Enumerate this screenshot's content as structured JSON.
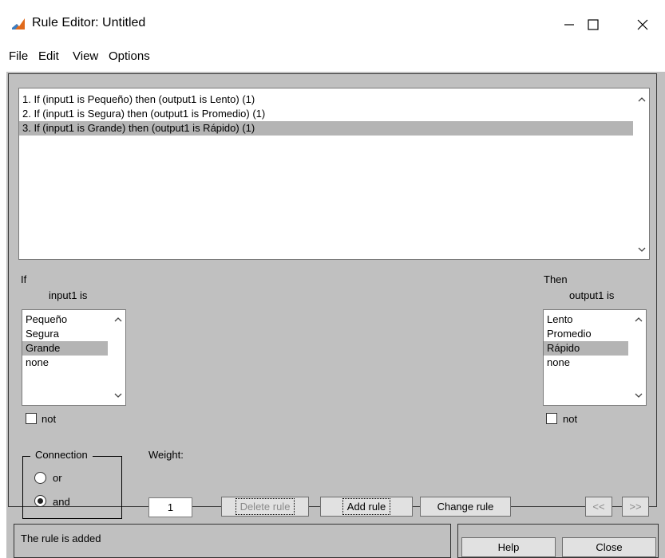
{
  "window": {
    "title": "Rule Editor: Untitled",
    "minimize_glyph": "—",
    "maximize_glyph": "☐",
    "close_glyph": "✕"
  },
  "menu": [
    "File",
    "Edit",
    "View",
    "Options"
  ],
  "rules": [
    "1. If (input1 is Pequeño) then (output1 is Lento) (1)",
    "2. If (input1 is Segura) then (output1 is Promedio) (1)",
    "3. If (input1 is Grande) then (output1 is Rápido) (1)"
  ],
  "selected_rule_index": 2,
  "if_section": {
    "label": "If",
    "variable_label": "input1 is",
    "options": [
      "Pequeño",
      "Segura",
      "Grande",
      "none"
    ],
    "selected_index": 2,
    "not_label": "not",
    "not_checked": false
  },
  "then_section": {
    "label": "Then",
    "variable_label": "output1 is",
    "options": [
      "Lento",
      "Promedio",
      "Rápido",
      "none"
    ],
    "selected_index": 2,
    "not_label": "not",
    "not_checked": false
  },
  "connection": {
    "label": "Connection",
    "options": [
      "or",
      "and"
    ],
    "selected": "and"
  },
  "weight": {
    "label": "Weight:",
    "value": "1"
  },
  "buttons": {
    "delete_rule": "Delete rule",
    "add_rule": "Add rule",
    "change_rule": "Change rule",
    "prev": "<<",
    "next": ">>",
    "help": "Help",
    "close": "Close"
  },
  "status_text": "The rule is added"
}
